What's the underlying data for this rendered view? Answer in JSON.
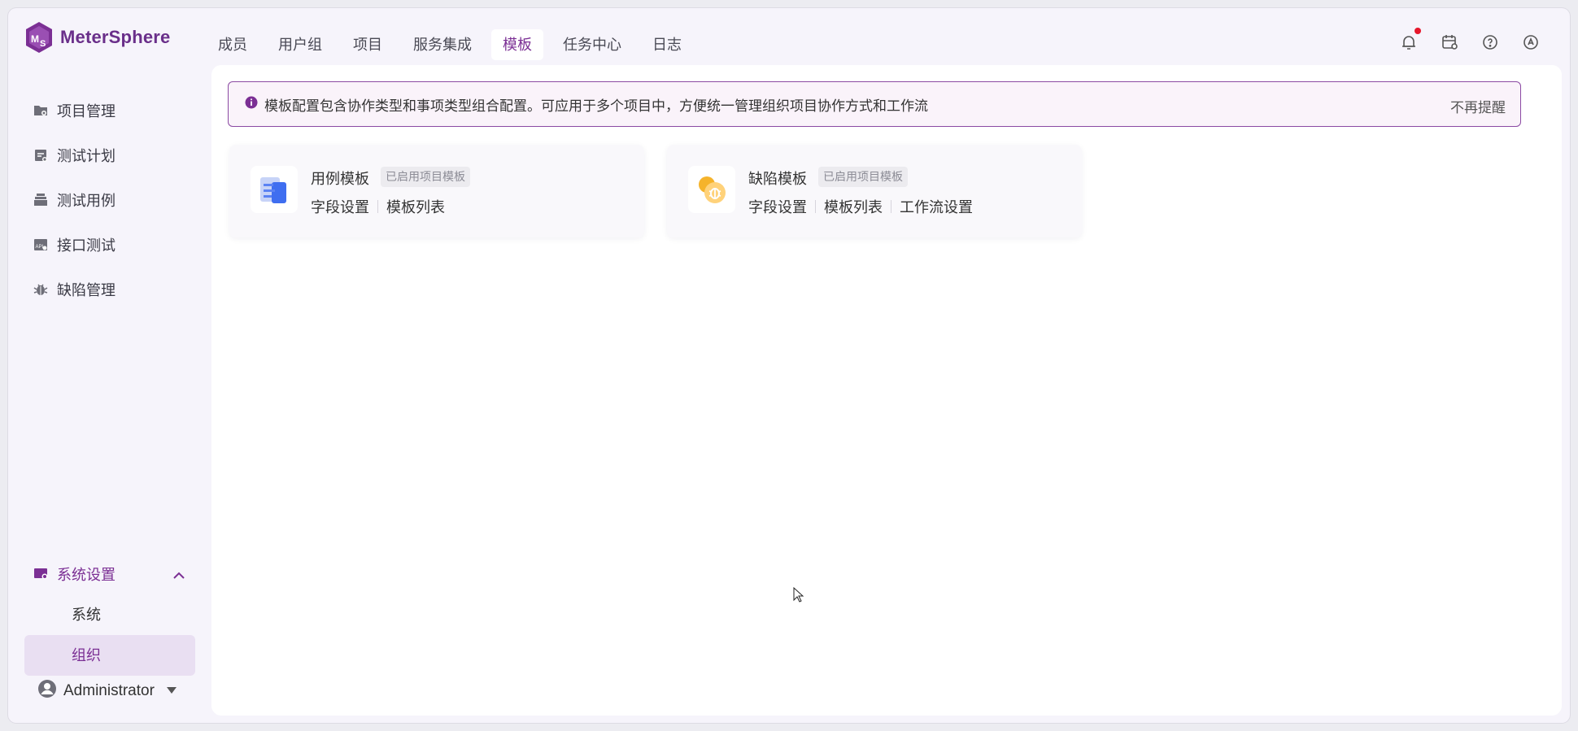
{
  "app": {
    "name": "MeterSphere"
  },
  "nav": {
    "items": [
      {
        "label": "成员",
        "active": false
      },
      {
        "label": "用户组",
        "active": false
      },
      {
        "label": "项目",
        "active": false
      },
      {
        "label": "服务集成",
        "active": false
      },
      {
        "label": "模板",
        "active": true
      },
      {
        "label": "任务中心",
        "active": false
      },
      {
        "label": "日志",
        "active": false
      }
    ]
  },
  "top_icons": [
    "bell-icon",
    "calendar-icon",
    "help-icon",
    "language-icon"
  ],
  "sidebar": {
    "items": [
      {
        "label": "项目管理",
        "icon": "folder-icon"
      },
      {
        "label": "测试计划",
        "icon": "test-plan-icon"
      },
      {
        "label": "测试用例",
        "icon": "case-stack-icon"
      },
      {
        "label": "接口测试",
        "icon": "api-icon"
      },
      {
        "label": "缺陷管理",
        "icon": "bug-icon"
      }
    ],
    "system_settings": {
      "label": "系统设置",
      "expanded": true
    },
    "sub_items": [
      {
        "label": "系统",
        "active": false
      },
      {
        "label": "组织",
        "active": true
      }
    ],
    "user": {
      "name": "Administrator"
    }
  },
  "alert": {
    "text": "模板配置包含协作类型和事项类型组合配置。可应用于多个项目中，方便统一管理组织项目协作方式和工作流",
    "close_label": "不再提醒"
  },
  "cards": [
    {
      "title": "用例模板",
      "badge": "已启用项目模板",
      "links": [
        "字段设置",
        "模板列表"
      ],
      "icon": "case-template-icon"
    },
    {
      "title": "缺陷模板",
      "badge": "已启用项目模板",
      "links": [
        "字段设置",
        "模板列表",
        "工作流设置"
      ],
      "icon": "bug-template-icon"
    }
  ],
  "colors": {
    "primary": "#7b2f94",
    "alert_border": "#8b4aa3",
    "active_bg": "#e9dff2",
    "notification_dot": "#e6172b"
  }
}
